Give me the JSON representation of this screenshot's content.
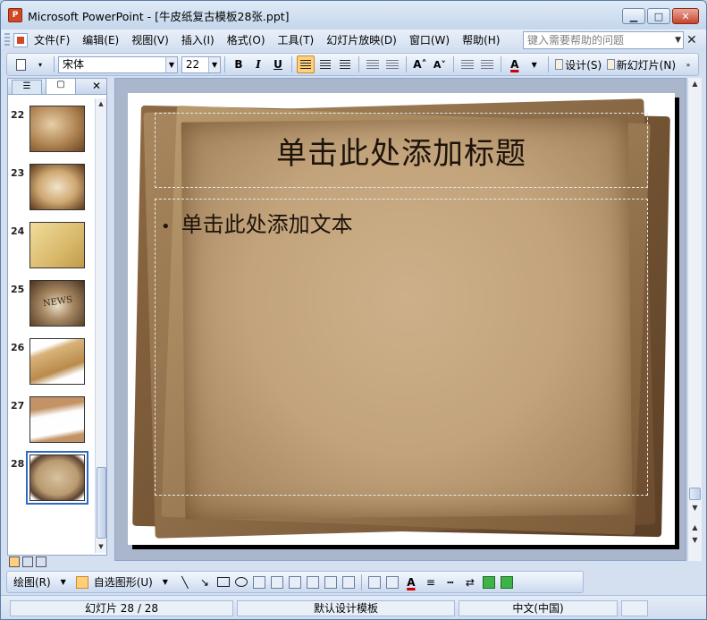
{
  "window": {
    "app_icon_letter": "P",
    "title": "Microsoft PowerPoint - [牛皮纸复古模板28张.ppt]",
    "minimize": "▁",
    "maximize": "□",
    "close": "✕"
  },
  "menu": {
    "items": [
      "文件(F)",
      "编辑(E)",
      "视图(V)",
      "插入(I)",
      "格式(O)",
      "工具(T)",
      "幻灯片放映(D)",
      "窗口(W)",
      "帮助(H)"
    ],
    "help_placeholder": "键入需要帮助的问题",
    "doc_close": "✕"
  },
  "format_toolbar": {
    "font_name": "宋体",
    "font_size": "22",
    "bold": "B",
    "italic": "I",
    "underline": "U",
    "increase_font": "A˄",
    "decrease_font": "A˅",
    "font_color": "A",
    "design_label": "设计(S)",
    "new_slide_label": "新幻灯片(N)"
  },
  "slide_pane": {
    "tab_outline": "☰",
    "tab_slides": "▢",
    "close": "✕",
    "slides": [
      {
        "num": "22",
        "cls": "t22"
      },
      {
        "num": "23",
        "cls": "t23"
      },
      {
        "num": "24",
        "cls": "t24"
      },
      {
        "num": "25",
        "cls": "t25",
        "label": "NEWS"
      },
      {
        "num": "26",
        "cls": "t26"
      },
      {
        "num": "27",
        "cls": "t27"
      },
      {
        "num": "28",
        "cls": "t28",
        "selected": true
      }
    ]
  },
  "slide": {
    "title_placeholder": "单击此处添加标题",
    "body_placeholder": "单击此处添加文本",
    "bullet": "•"
  },
  "draw_toolbar": {
    "draw_label": "绘图(R)",
    "autoshapes_label": "自选图形(U)"
  },
  "status": {
    "slide_info": "幻灯片 28 / 28",
    "design": "默认设计模板",
    "language": "中文(中国)"
  }
}
